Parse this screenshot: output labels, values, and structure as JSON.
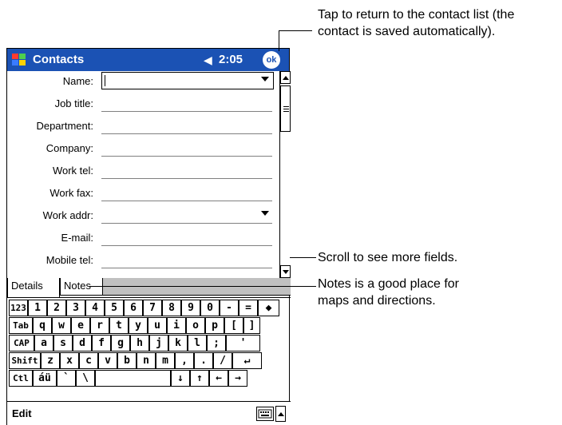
{
  "titlebar": {
    "app_title": "Contacts",
    "time": "2:05",
    "ok_label": "ok",
    "speaker_glyph": "◀€"
  },
  "form": {
    "fields": [
      {
        "label": "Name:"
      },
      {
        "label": "Job title:"
      },
      {
        "label": "Department:"
      },
      {
        "label": "Company:"
      },
      {
        "label": "Work tel:"
      },
      {
        "label": "Work fax:"
      },
      {
        "label": "Work addr:"
      },
      {
        "label": "E-mail:"
      },
      {
        "label": "Mobile tel:"
      }
    ]
  },
  "tabs": {
    "details": "Details",
    "notes": "Notes"
  },
  "keyboard": {
    "rows": [
      [
        "123",
        "1",
        "2",
        "3",
        "4",
        "5",
        "6",
        "7",
        "8",
        "9",
        "0",
        "-",
        "=",
        "◆"
      ],
      [
        "Tab",
        "q",
        "w",
        "e",
        "r",
        "t",
        "y",
        "u",
        "i",
        "o",
        "p",
        "[",
        "]"
      ],
      [
        "CAP",
        "a",
        "s",
        "d",
        "f",
        "g",
        "h",
        "j",
        "k",
        "l",
        ";",
        "'"
      ],
      [
        "Shift",
        "z",
        "x",
        "c",
        "v",
        "b",
        "n",
        "m",
        ",",
        ".",
        "/",
        "↵"
      ],
      [
        "Ctl",
        "áü",
        "`",
        "\\",
        "",
        "↓",
        "↑",
        "←",
        "→"
      ]
    ]
  },
  "menubar": {
    "edit": "Edit"
  },
  "callouts": {
    "ok": [
      "Tap to return to the contact list (the",
      "contact is saved automatically)."
    ],
    "scroll": [
      "Scroll to see more fields."
    ],
    "notes": [
      "Notes is a good place for",
      "maps and directions."
    ]
  },
  "colors": {
    "titlebar": "#1b52b4",
    "tab_fill": "#c0c0c0"
  }
}
